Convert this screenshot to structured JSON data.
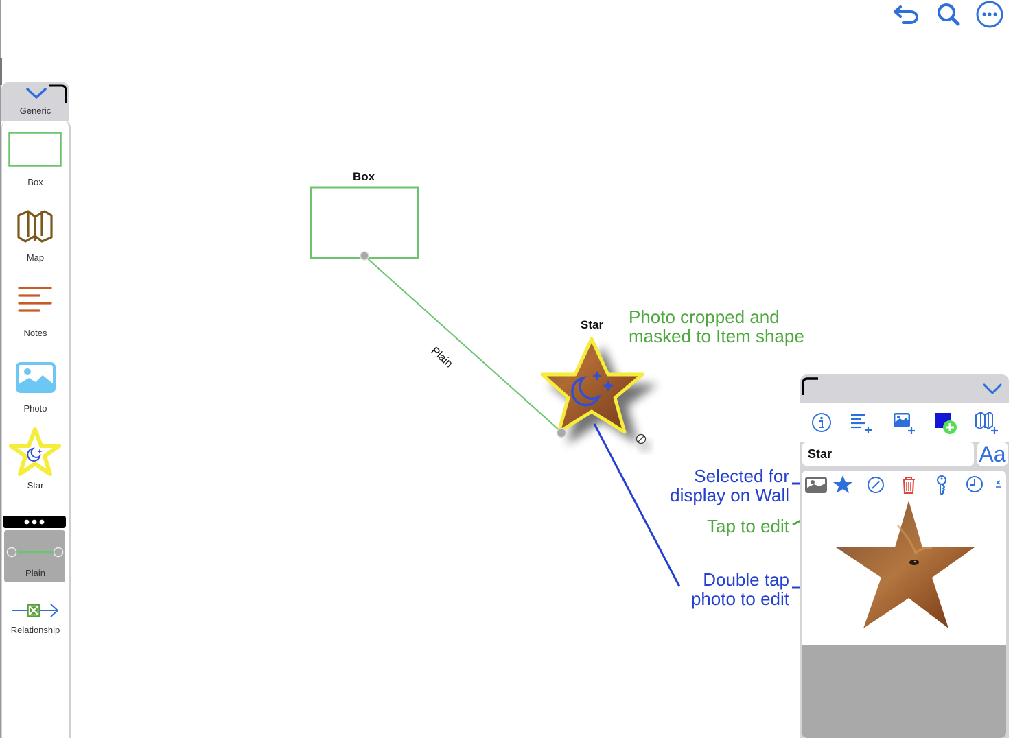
{
  "toolbar": {
    "undo_icon": "undo-arrow-icon",
    "search_icon": "search-icon",
    "more_icon": "ellipsis-circle-icon"
  },
  "sidebar": {
    "category_label": "Generic",
    "items": [
      {
        "label": "Box",
        "icon": "box-outline-icon"
      },
      {
        "label": "Map",
        "icon": "map-icon"
      },
      {
        "label": "Notes",
        "icon": "notes-lines-icon"
      },
      {
        "label": "Photo",
        "icon": "photo-icon"
      },
      {
        "label": "Star",
        "icon": "star-moon-icon"
      },
      {
        "label": "Plain",
        "icon": "plain-connector-icon",
        "selected": true
      },
      {
        "label": "Relationship",
        "icon": "relationship-arrow-icon"
      }
    ]
  },
  "canvas": {
    "box_item": {
      "title": "Box"
    },
    "star_item": {
      "title": "Star"
    },
    "connector_label": "Plain"
  },
  "annotations": {
    "photo_masked_line1": "Photo cropped and",
    "photo_masked_line2": "masked to Item shape",
    "selected_line1": "Selected for",
    "selected_line2": "display on Wall",
    "tap_to_edit": "Tap to edit",
    "double_tap_line1": "Double tap",
    "double_tap_line2": "photo to edit"
  },
  "inspector": {
    "name_value": "Star",
    "font_button": "Aa",
    "toolbar_icons": [
      "info-icon",
      "add-notes-icon",
      "add-photo-icon",
      "add-shape-icon",
      "add-map-icon"
    ],
    "photo_icons": [
      "photo-thumbnail-icon",
      "star-display-icon",
      "edit-pencil-icon",
      "trash-icon",
      "key-icon",
      "clock-icon",
      "close-small-icon"
    ]
  },
  "colors": {
    "accent_blue": "#2f6fdc",
    "annotation_blue": "#2440d0",
    "annotation_green": "#4ea83f",
    "box_green": "#6cc46f",
    "star_yellow": "#f6ec3c",
    "trash_red": "#e0463c"
  }
}
